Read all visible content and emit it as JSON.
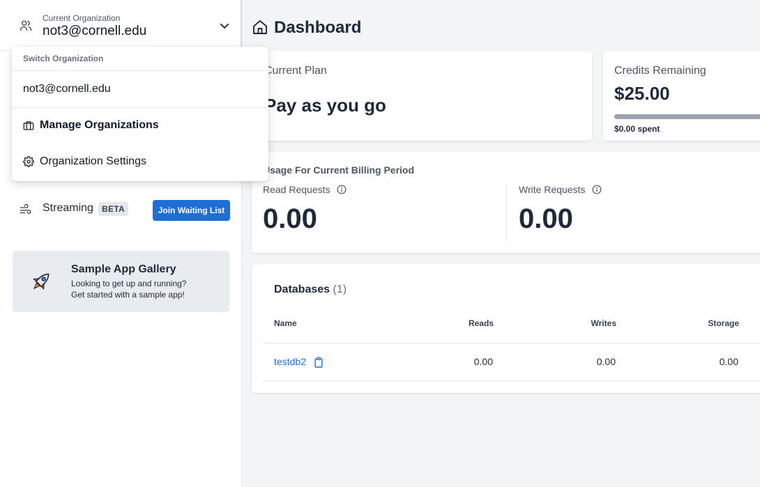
{
  "colors": {
    "accent": "#1d6fd6",
    "sidebar_bg": "#ffffff",
    "main_bg": "#f3f4f6"
  },
  "org_switcher": {
    "caption": "Current Organization",
    "name": "not3@cornell.edu"
  },
  "dropdown": {
    "header": "Switch Organization",
    "org": "not3@cornell.edu",
    "manage": "Manage Organizations",
    "settings": "Organization Settings"
  },
  "sidebar": {
    "streaming": {
      "label": "Streaming",
      "badge": "BETA",
      "button": "Join Waiting List"
    },
    "gallery": {
      "title": "Sample App Gallery",
      "line1": "Looking to get up and running?",
      "line2": "Get started with a sample app!"
    }
  },
  "page": {
    "title": "Dashboard"
  },
  "plan": {
    "caption": "Current Plan",
    "value": "Pay as you go"
  },
  "credits": {
    "caption": "Credits Remaining",
    "amount": "$25.00",
    "spent": "$0.00 spent",
    "used_fraction": 1.0
  },
  "usage": {
    "caption": "Usage For Current Billing Period",
    "read": {
      "label": "Read Requests",
      "value": "0.00"
    },
    "write": {
      "label": "Write Requests",
      "value": "0.00"
    }
  },
  "databases": {
    "title": "Databases",
    "count": "(1)",
    "columns": [
      "Name",
      "Reads",
      "Writes",
      "Storage"
    ],
    "rows": [
      {
        "name": "testdb2",
        "reads": "0.00",
        "writes": "0.00",
        "storage": "0.00"
      }
    ]
  }
}
